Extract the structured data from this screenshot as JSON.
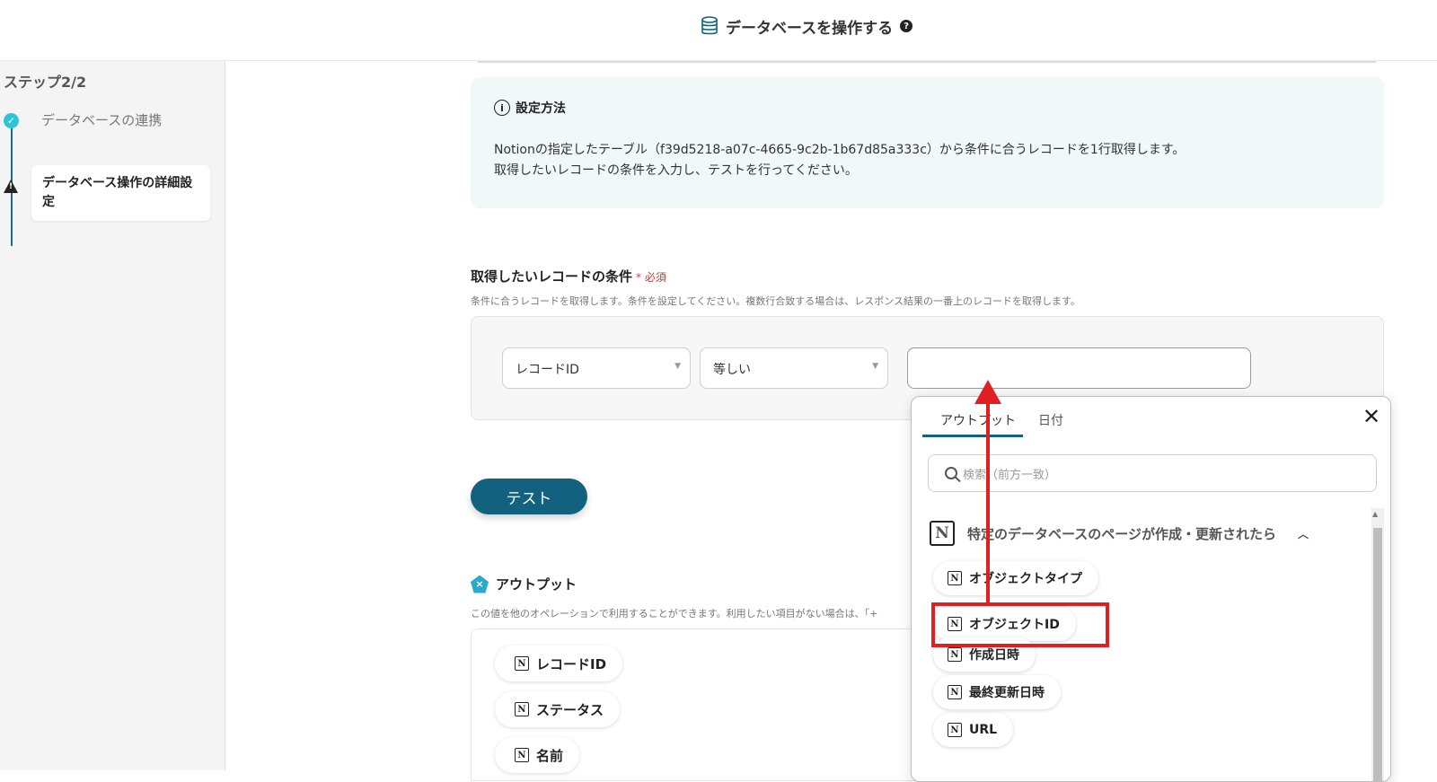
{
  "header": {
    "title": "データベースを操作する",
    "help_icon": "?"
  },
  "sidebar": {
    "step_counter": "ステップ2/2",
    "steps": [
      {
        "label": "データベースの連携",
        "status": "done"
      },
      {
        "label": "データベース操作の詳細設定",
        "status": "warning"
      }
    ]
  },
  "info": {
    "heading": "設定方法",
    "line1": "Notionの指定したテーブル（f39d5218-a07c-4665-9c2b-1b67d85a333c）から条件に合うレコードを1行取得します。",
    "line2": "取得したいレコードの条件を入力し、テストを行ってください。"
  },
  "condition": {
    "label": "取得したいレコードの条件",
    "required": "* 必須",
    "description": "条件に合うレコードを取得します。条件を設定してください。複数行合致する場合は、レスポンス結果の一番上のレコードを取得します。",
    "field_select": "レコードID",
    "operator_select": "等しい",
    "value": ""
  },
  "test_button": "テスト",
  "output": {
    "heading": "アウトプット",
    "description": "この値を他のオペレーションで利用することができます。利用したい項目がない場合は、「+",
    "chips": [
      "レコードID",
      "ステータス",
      "名前"
    ]
  },
  "popover": {
    "tabs": [
      "アウトプット",
      "日付"
    ],
    "search_placeholder": "検索（前方一致）",
    "group_title": "特定のデータベースのページが作成・更新されたら",
    "items": [
      "オブジェクトタイプ",
      "オブジェクトID",
      "作成日時",
      "最終更新日時",
      "URL"
    ],
    "highlighted_item": "オブジェクトID"
  },
  "colors": {
    "accent": "#12617e",
    "annotation": "#e02020",
    "done": "#2ec4d8"
  }
}
